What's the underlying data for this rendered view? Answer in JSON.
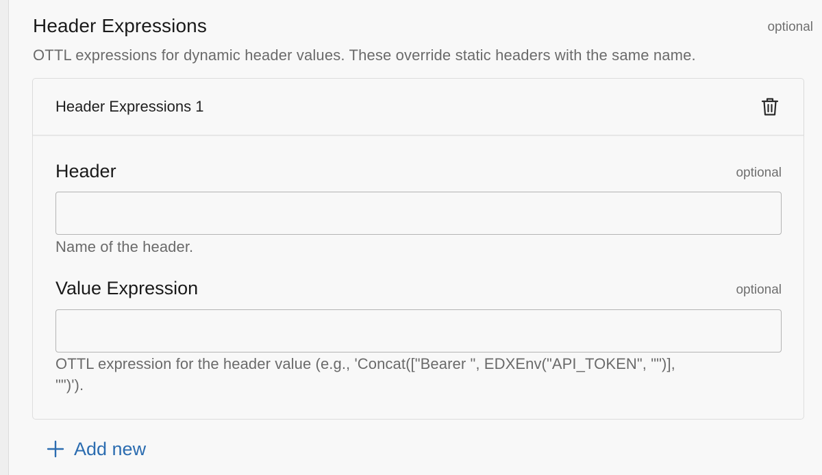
{
  "section": {
    "title": "Header Expressions",
    "optional_label": "optional",
    "description": "OTTL expressions for dynamic header values. These override static headers with the same name."
  },
  "item": {
    "title": "Header Expressions 1",
    "delete_icon": "trash-icon",
    "fields": {
      "header": {
        "label": "Header",
        "optional_label": "optional",
        "value": "",
        "placeholder": "",
        "help": "Name of the header."
      },
      "value_expression": {
        "label": "Value Expression",
        "optional_label": "optional",
        "value": "",
        "placeholder": "",
        "help_line1": "OTTL expression for the header value (e.g., 'Concat([\"Bearer \", EDXEnv(\"API_TOKEN\", \"\")],",
        "help_line2": "\"\")')."
      }
    }
  },
  "add_new": {
    "label": "Add new",
    "icon": "plus-icon"
  },
  "colors": {
    "accent": "#2b6cb0",
    "muted_text": "#6a6a6a",
    "border": "#dddddd"
  }
}
